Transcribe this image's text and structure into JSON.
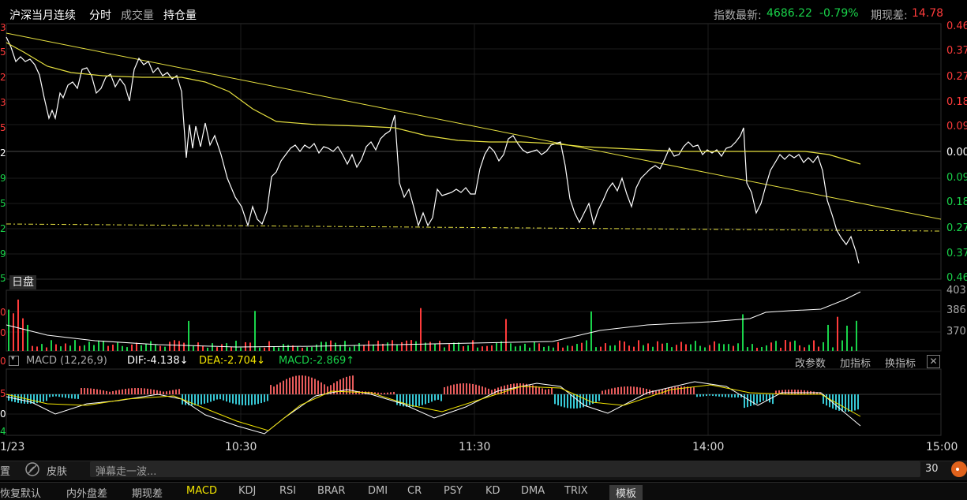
{
  "header": {
    "title": "沪深当月连续",
    "tabs": [
      "分时",
      "成交量",
      "持仓量"
    ],
    "index_label": "指数最新:",
    "index_value": "4686.22",
    "index_change": "-0.79%",
    "basis_label": "期现差:",
    "basis_value": "14.78"
  },
  "price_axis": {
    "right": [
      "0.46",
      "0.37",
      "0.27",
      "0.18",
      "0.09",
      "0.00",
      "0.09",
      "0.18",
      "0.27",
      "0.37",
      "0.46"
    ],
    "left": [
      "3",
      "5",
      "2",
      "3",
      "5",
      "2",
      "9",
      "5",
      "2",
      "9",
      "5"
    ]
  },
  "day_label": "日盘",
  "volume_axis": {
    "right": [
      "403",
      "386",
      "370"
    ],
    "left": [
      "",
      "0",
      "0"
    ]
  },
  "macd": {
    "name": "MACD",
    "params": "(12,26,9)",
    "dif": "DIF:-4.138↓",
    "dea": "DEA:-2.704↓",
    "macd": "MACD:-2.869↑",
    "buttons": [
      "改参数",
      "加指标",
      "换指标"
    ],
    "left_axis": [
      "0",
      "5",
      "0",
      "4"
    ]
  },
  "time_axis": [
    "1/23",
    "10:30",
    "11:30",
    "14:00",
    "15:00"
  ],
  "toolbar": {
    "left": "置",
    "skin": "皮肤",
    "danmaku_placeholder": "弹幕走一波...",
    "count": "30"
  },
  "bottom_tabs": [
    "恢复默认",
    "内外盘差",
    "期现差",
    "MACD",
    "KDJ",
    "RSI",
    "BRAR",
    "DMI",
    "CR",
    "PSY",
    "KD",
    "DMA",
    "TRIX",
    "模板"
  ],
  "colors": {
    "up": "#ff3b3b",
    "down": "#19d34a",
    "avg_line": "#e6e040",
    "price_line": "#ffffff",
    "macd_up": "#e85c5c",
    "macd_down": "#37c9d6"
  }
}
